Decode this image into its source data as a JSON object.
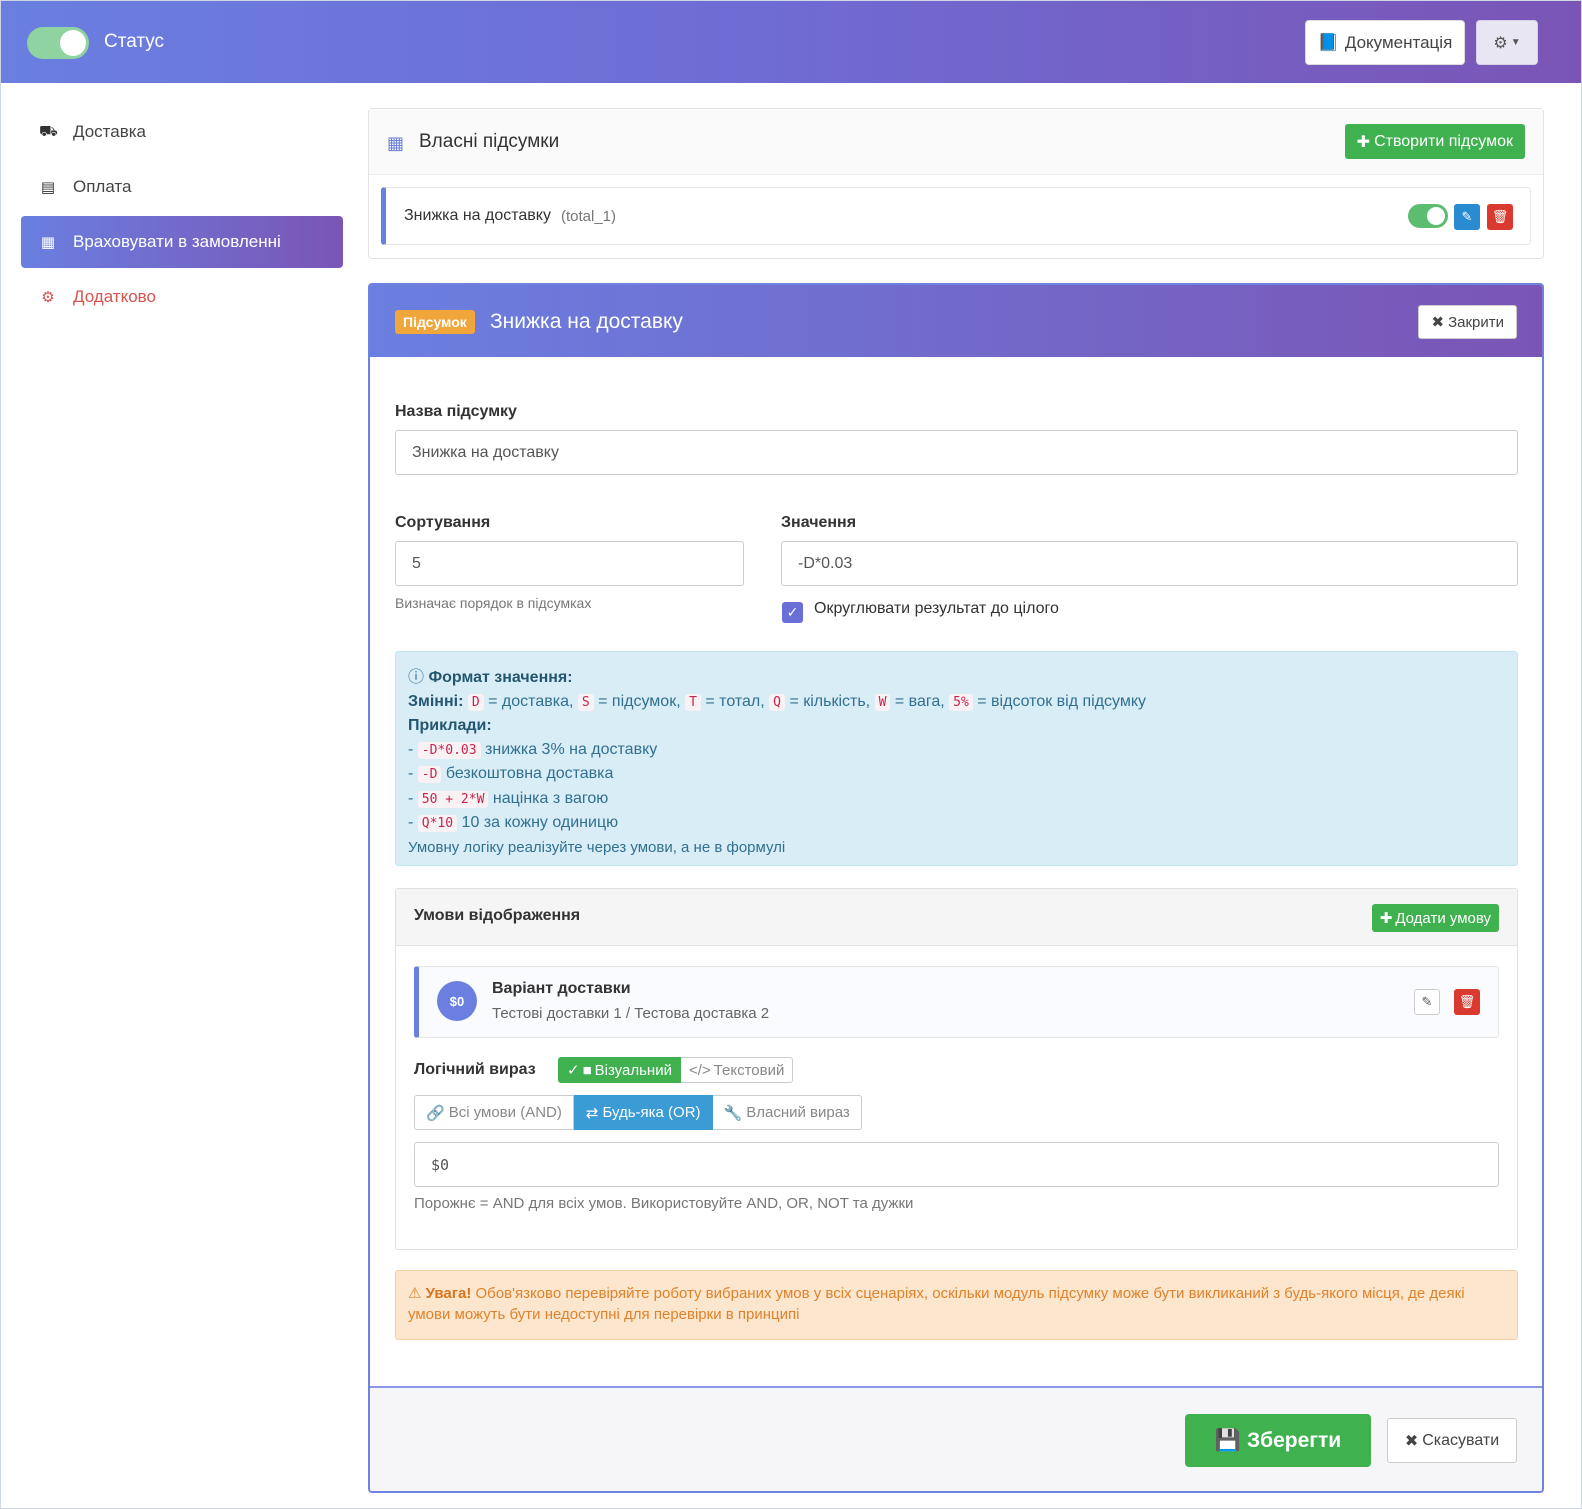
{
  "header": {
    "status_label": "Статус",
    "status_on": true,
    "docs_label": "Документація",
    "icons": {
      "docs": "book-icon",
      "settings": "gear-icon"
    }
  },
  "sidebar": {
    "items": [
      {
        "label": "Доставка",
        "icon": "truck-icon"
      },
      {
        "label": "Оплата",
        "icon": "credit-card-icon"
      },
      {
        "label": "Враховувати в замовленні",
        "icon": "calculator-icon",
        "active": true
      },
      {
        "label": "Додатково",
        "icon": "gears-icon",
        "color": "#d9534f"
      }
    ]
  },
  "totals": {
    "title": "Власні підсумки",
    "create_label": "Створити підсумок",
    "items": [
      {
        "name": "Знижка на доставку",
        "code": "(total_1)",
        "enabled": true
      }
    ]
  },
  "editor": {
    "badge": "Підсумок",
    "title": "Знижка на доставку",
    "close_label": "Закрити",
    "name_label": "Назва підсумку",
    "name_value": "Знижка на доставку",
    "sort_label": "Сортування",
    "sort_value": "5",
    "sort_help": "Визначає порядок в підсумках",
    "value_label": "Значення",
    "value_value": "-D*0.03",
    "round_label": "Округлювати результат до цілого",
    "round_checked": true,
    "info": {
      "title": "Формат значення:",
      "vars_label": "Змінні:",
      "vars": [
        {
          "code": "D",
          "desc": "= доставка,"
        },
        {
          "code": "S",
          "desc": "= підсумок,"
        },
        {
          "code": "T",
          "desc": "= тотал,"
        },
        {
          "code": "Q",
          "desc": "= кількість,"
        },
        {
          "code": "W",
          "desc": "= вага,"
        },
        {
          "code": "5%",
          "desc": "= відсоток від підсумку"
        }
      ],
      "examples_label": "Приклади:",
      "examples": [
        {
          "code": "-D*0.03",
          "desc": "знижка 3% на доставку"
        },
        {
          "code": "-D",
          "desc": "безкоштовна доставка"
        },
        {
          "code": "50 + 2*W",
          "desc": "націнка з вагою"
        },
        {
          "code": "Q*10",
          "desc": "10 за кожну одиницю"
        }
      ],
      "note": "Умовну логіку реалізуйте через умови, а не в формулі"
    },
    "conditions": {
      "title": "Умови відображення",
      "add_label": "Додати умову",
      "items": [
        {
          "id": "$0",
          "name": "Варіант доставки",
          "sub": "Тестові доставки 1 / Тестова доставка 2"
        }
      ],
      "logic_label": "Логічний вираз",
      "mode_visual": "Візуальний",
      "mode_text": "Текстовий",
      "op_and": "Всі умови (AND)",
      "op_or": "Будь-яка (OR)",
      "op_custom": "Власний вираз",
      "expr_value": "$0",
      "expr_help": "Порожнє = AND для всіх умов. Використовуйте AND, OR, NOT та дужки"
    },
    "warning": {
      "strong": "Увага!",
      "text": "Обов'язково перевіряйте роботу вибраних умов у всіх сценаріях, оскільки модуль підсумку може бути викликаний з будь-якого місця, де деякі умови можуть бути недоступні для перевірки в принципі"
    },
    "save_label": "Зберегти",
    "cancel_label": "Скасувати"
  },
  "colors": {
    "header_gradient_start": "#6a7fe0",
    "header_gradient_end": "#7a55b5",
    "success": "#3fb24f",
    "danger": "#d9392f",
    "info_bg": "#d9edf7",
    "warning_bg": "#fce6cd",
    "badge": "#f0a63a"
  }
}
